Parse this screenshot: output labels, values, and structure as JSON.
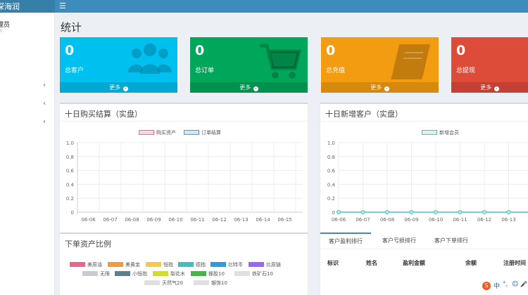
{
  "topbar": {
    "brand": "深海润",
    "menu_icon": "☰"
  },
  "sidebar": {
    "user_label": "理员",
    "user_sub": "n",
    "chevrons": [
      "‹",
      "‹",
      "‹"
    ]
  },
  "page": {
    "title": "统计"
  },
  "stats": [
    {
      "value": "0",
      "label": "总客户",
      "more": "更多",
      "icon": "users-icon",
      "color": "#00c0ef"
    },
    {
      "value": "0",
      "label": "总订单",
      "more": "更多",
      "icon": "cart-icon",
      "color": "#00a65a"
    },
    {
      "value": "0",
      "label": "总充值",
      "more": "更多",
      "icon": "book-icon",
      "color": "#f39c12"
    },
    {
      "value": "0",
      "label": "总提现",
      "more": "更多",
      "icon": "chart-icon",
      "color": "#dd4b39"
    }
  ],
  "panels": {
    "buy": {
      "title": "十日购买结算（实盘）"
    },
    "customers": {
      "title": "十日新增客户（实盘）"
    },
    "ratio": {
      "title": "下单资产比例"
    }
  },
  "ranking": {
    "tabs": [
      "客户盈利排行",
      "客户亏损排行",
      "客户下单排行"
    ],
    "columns": [
      "标识",
      "姓名",
      "盈利金额",
      "余额",
      "注册时间"
    ]
  },
  "asset_legend": [
    {
      "name": "美原油",
      "color": "#f0648c"
    },
    {
      "name": "美黄金",
      "color": "#f59a3c"
    },
    {
      "name": "恒指",
      "color": "#f5c94a"
    },
    {
      "name": "德指",
      "color": "#3fbfbf"
    },
    {
      "name": "比特币",
      "color": "#2f9ae0"
    },
    {
      "name": "比原链",
      "color": "#9966ff"
    },
    {
      "name": "无限",
      "color": "#c9cbcf"
    },
    {
      "name": "小恒指",
      "color": "#607d8b"
    },
    {
      "name": "梨花木",
      "color": "#cddc39"
    },
    {
      "name": "橡胶10",
      "color": "#4caf50"
    },
    {
      "name": "铁矿石10",
      "color": "#e0e0e0"
    },
    {
      "name": "天然气20",
      "color": "#e0e0e0"
    },
    {
      "name": "银饰10",
      "color": "#e0e0e0"
    }
  ],
  "tray": {
    "logo": "S",
    "lang": "中",
    "punct": "°,",
    "emoji": "☺",
    "mic": "🎤"
  },
  "chart_data": [
    {
      "type": "bar",
      "categories": [
        "06-06",
        "06-07",
        "06-08",
        "06-09",
        "06-10",
        "06-11",
        "06-12",
        "06-13",
        "06-14",
        "06-15"
      ],
      "series": [
        {
          "name": "购买资产",
          "values": [
            0,
            0,
            0,
            0,
            0,
            0,
            0,
            0,
            0,
            0
          ],
          "color": "#ffb1c1"
        },
        {
          "name": "订单结算",
          "values": [
            0,
            0,
            0,
            0,
            0,
            0,
            0,
            0,
            0,
            0
          ],
          "color": "#9ad0f5"
        }
      ],
      "yticks": [
        "0",
        "0.2",
        "0.4",
        "0.6",
        "0.8",
        "1.0"
      ],
      "ylim": [
        0,
        1.0
      ],
      "grid": true,
      "legend": "top"
    },
    {
      "type": "line",
      "categories": [
        "06-06",
        "06-07",
        "06-08",
        "06-09",
        "06-10",
        "06-11",
        "06-12",
        "06-13"
      ],
      "series": [
        {
          "name": "新增会员",
          "values": [
            0,
            0,
            0,
            0,
            0,
            0,
            0,
            0
          ],
          "color": "#4bc0c0"
        }
      ],
      "yticks": [
        "0",
        "0.2",
        "0.4",
        "0.6",
        "0.8",
        "1.0"
      ],
      "ylim": [
        0,
        1.0
      ],
      "grid": true,
      "legend": "top"
    }
  ]
}
